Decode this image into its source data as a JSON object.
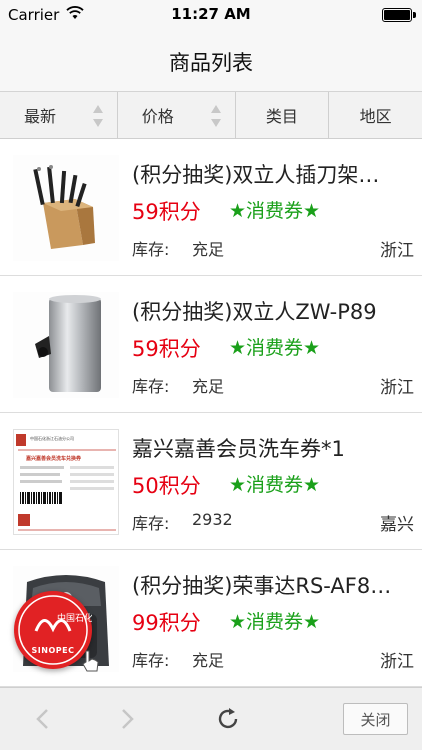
{
  "status_bar": {
    "carrier": "Carrier",
    "time": "11:27 AM"
  },
  "nav": {
    "title": "商品列表"
  },
  "filters": [
    {
      "label": "最新",
      "sortable": true
    },
    {
      "label": "价格",
      "sortable": true
    },
    {
      "label": "类目",
      "sortable": false
    },
    {
      "label": "地区",
      "sortable": false
    }
  ],
  "products": [
    {
      "title": "(积分抽奖)双立人插刀架…",
      "price": "59积分",
      "coupon": "★消费券★",
      "stock_label": "库存:",
      "stock": "充足",
      "region": "浙江",
      "image": "knife-block"
    },
    {
      "title": "(积分抽奖)双立人ZW-P89",
      "price": "59积分",
      "coupon": "★消费券★",
      "stock_label": "库存:",
      "stock": "充足",
      "region": "浙江",
      "image": "steel-kettle"
    },
    {
      "title": "嘉兴嘉善会员洗车券*1",
      "price": "50积分",
      "coupon": "★消费券★",
      "stock_label": "库存:",
      "stock": "2932",
      "region": "嘉兴",
      "image": "car-wash-voucher"
    },
    {
      "title": "(积分抽奖)荣事达RS-AF8…",
      "price": "99积分",
      "coupon": "★消费券★",
      "stock_label": "库存:",
      "stock": "充足",
      "region": "浙江",
      "image": "air-fryer"
    }
  ],
  "voucher_image_text": {
    "org": "中国石化浙江石油分公司",
    "heading": "嘉兴嘉善会员洗车兑换券"
  },
  "badge": {
    "logo_text": "SINOPEC",
    "chinese": "中国石化"
  },
  "toolbar": {
    "close_label": "关闭"
  },
  "colors": {
    "price": "#e60012",
    "coupon": "#1aa01a",
    "badge": "#e12224"
  }
}
